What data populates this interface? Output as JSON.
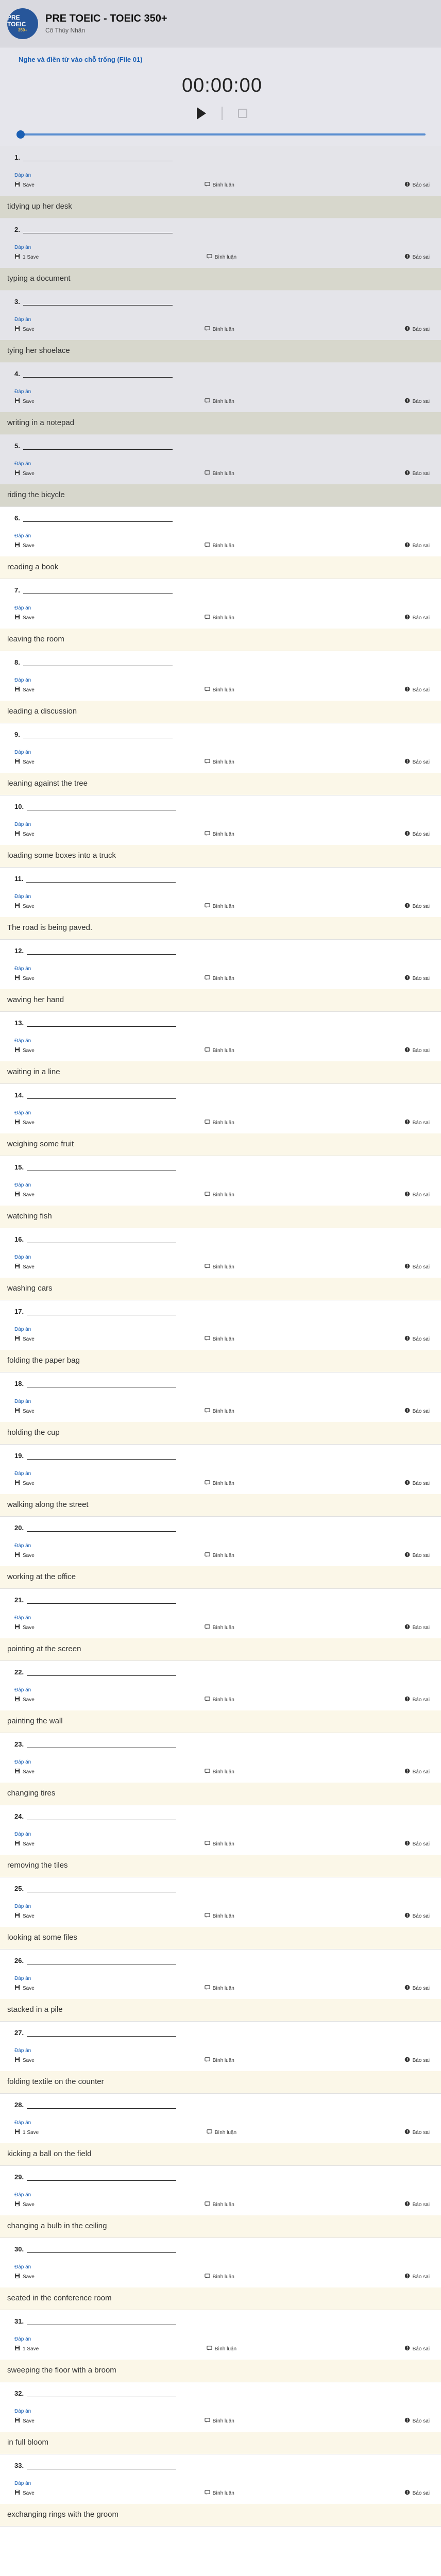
{
  "header": {
    "logo_line1": "PRE TOEIC",
    "logo_line2": "350+",
    "course_title": "PRE TOEIC - TOEIC 350+",
    "course_subtitle": "Cô Thủy Nhân"
  },
  "player": {
    "lesson_title": "Nghe và điền từ vào chỗ trống (File 01)",
    "time": "00:00:00",
    "progress": 0.0
  },
  "labels": {
    "show_answer": "Đáp án",
    "save": "Save",
    "saved_one": "1 Save",
    "discuss": "Bình luận",
    "report": "Báo sai"
  },
  "items": [
    {
      "num": "1.",
      "save": "Save",
      "answer": "tidying up her desk",
      "done": true
    },
    {
      "num": "2.",
      "save": "1 Save",
      "answer": "typing a document",
      "done": true
    },
    {
      "num": "3.",
      "save": "Save",
      "answer": "tying her shoelace",
      "done": true
    },
    {
      "num": "4.",
      "save": "Save",
      "answer": "writing in a notepad",
      "done": true
    },
    {
      "num": "5.",
      "save": "Save",
      "answer": "riding the bicycle",
      "done": true
    },
    {
      "num": "6.",
      "save": "Save",
      "answer": "reading a book",
      "done": false
    },
    {
      "num": "7.",
      "save": "Save",
      "answer": "leaving the room",
      "done": false
    },
    {
      "num": "8.",
      "save": "Save",
      "answer": "leading a discussion",
      "done": false
    },
    {
      "num": "9.",
      "save": "Save",
      "answer": "leaning against the tree",
      "done": false
    },
    {
      "num": "10.",
      "save": "Save",
      "answer": "loading some boxes into a truck",
      "done": false
    },
    {
      "num": "11.",
      "save": "Save",
      "answer": "The road is being paved.",
      "done": false
    },
    {
      "num": "12.",
      "save": "Save",
      "answer": "waving her hand",
      "done": false
    },
    {
      "num": "13.",
      "save": "Save",
      "answer": "waiting in a line",
      "done": false
    },
    {
      "num": "14.",
      "save": "Save",
      "answer": "weighing some fruit",
      "done": false
    },
    {
      "num": "15.",
      "save": "Save",
      "answer": "watching fish",
      "done": false
    },
    {
      "num": "16.",
      "save": "Save",
      "answer": "washing cars",
      "done": false
    },
    {
      "num": "17.",
      "save": "Save",
      "answer": "folding the paper bag",
      "done": false
    },
    {
      "num": "18.",
      "save": "Save",
      "answer": "holding the cup",
      "done": false
    },
    {
      "num": "19.",
      "save": "Save",
      "answer": "walking along the street",
      "done": false
    },
    {
      "num": "20.",
      "save": "Save",
      "answer": "working at the office",
      "done": false
    },
    {
      "num": "21.",
      "save": "Save",
      "answer": "pointing at the screen",
      "done": false
    },
    {
      "num": "22.",
      "save": "Save",
      "answer": "painting the wall",
      "done": false
    },
    {
      "num": "23.",
      "save": "Save",
      "answer": "changing tires",
      "done": false
    },
    {
      "num": "24.",
      "save": "Save",
      "answer": "removing the tiles",
      "done": false
    },
    {
      "num": "25.",
      "save": "Save",
      "answer": "looking at some files",
      "done": false
    },
    {
      "num": "26.",
      "save": "Save",
      "answer": "stacked in a pile",
      "done": false
    },
    {
      "num": "27.",
      "save": "Save",
      "answer": "folding textile on the counter",
      "done": false
    },
    {
      "num": "28.",
      "save": "1 Save",
      "answer": "kicking a ball on the field",
      "done": false
    },
    {
      "num": "29.",
      "save": "Save",
      "answer": "changing a bulb in the ceiling",
      "done": false
    },
    {
      "num": "30.",
      "save": "Save",
      "answer": "seated in the conference room",
      "done": false
    },
    {
      "num": "31.",
      "save": "1 Save",
      "answer": "sweeping the floor with a broom",
      "done": false
    },
    {
      "num": "32.",
      "save": "Save",
      "answer": "in full bloom",
      "done": false
    },
    {
      "num": "33.",
      "save": "Save",
      "answer": "exchanging rings with the groom",
      "done": false
    }
  ],
  "colors": {
    "accent": "#1a5fb4",
    "answer_bg": "#fbf7e8",
    "done_bg": "#e4e4e9"
  }
}
